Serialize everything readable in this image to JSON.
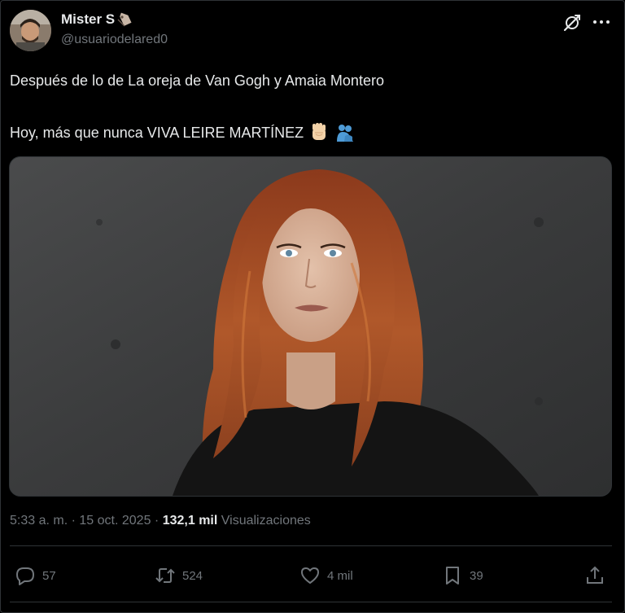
{
  "tweet": {
    "display_name": "Mister S",
    "handle": "@usuariodelared0",
    "line1": "Después de lo de La oreja de Van Gogh y Amaia Montero",
    "line2": "Hoy, más que nunca VIVA LEIRE MARTÍNEZ",
    "line2_emojis": [
      "raised-fist-icon",
      "people-hugging-icon"
    ],
    "media_alt": "Photo of a woman with long wavy auburn hair in a black top against a gray wall"
  },
  "meta": {
    "time": "5:33 a. m.",
    "sep1": "·",
    "date": "15 oct. 2025",
    "sep2": "·",
    "views_count": "132,1 mil",
    "views_label": "Visualizaciones"
  },
  "actions": {
    "reply_count": "57",
    "retweet_count": "524",
    "like_count": "4 mil",
    "bookmark_count": "39"
  },
  "colors": {
    "background": "#000000",
    "text": "#e7e9ea",
    "muted": "#71767b",
    "border": "#2f3336"
  }
}
